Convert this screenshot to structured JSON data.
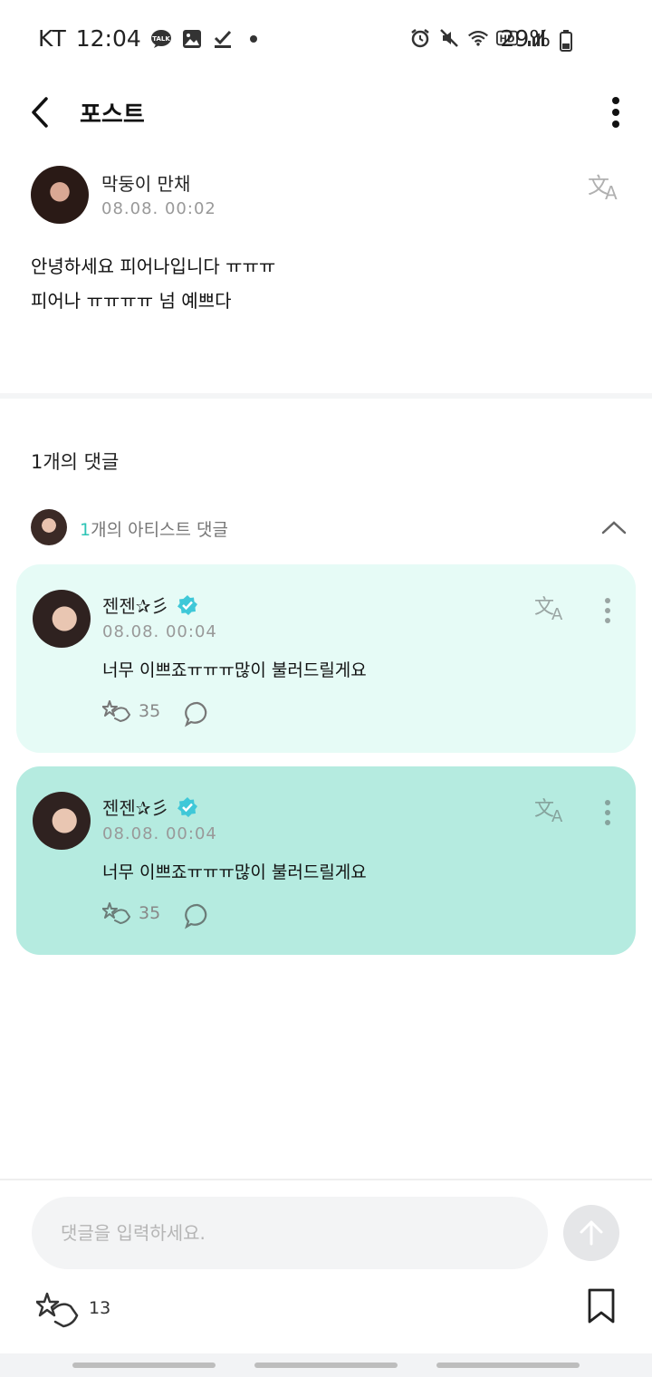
{
  "status_bar": {
    "carrier": "KT",
    "time": "12:04",
    "battery": "29%"
  },
  "header": {
    "title": "포스트"
  },
  "post": {
    "author": "막둥이 만채",
    "date": "08.08. 00:02",
    "body": "안녕하세요 피어나입니다 ㅠㅠㅠ\n피어나 ㅠㅠㅠㅠ 넘 예쁘다"
  },
  "comments_section": {
    "count_label": "1개의 댓글",
    "artist_label_num": "1",
    "artist_label_rest": "개의 아티스트 댓글"
  },
  "comments": [
    {
      "name": "젠젠✰彡",
      "date": "08.08. 00:04",
      "text": "너무 이쁘죠ㅠㅠㅠ많이 불러드릴게요",
      "likes": "35"
    },
    {
      "name": "젠젠✰彡",
      "date": "08.08. 00:04",
      "text": "너무 이쁘죠ㅠㅠㅠ많이 불러드릴게요",
      "likes": "35"
    }
  ],
  "bottom_bar": {
    "input_placeholder": "댓글을 입력하세요.",
    "like_count": "13"
  },
  "icons": {
    "back": "chevron-left-icon",
    "more": "more-vertical-icon",
    "translate": "translate-icon",
    "verified": "verified-badge-icon",
    "like": "star-hand-icon",
    "reply": "comment-bubble-icon",
    "send": "arrow-up-icon",
    "bookmark": "bookmark-icon",
    "collapse": "chevron-up-icon"
  },
  "colors": {
    "accent": "#2ec4b6",
    "card_light": "#e6fbf6",
    "card_highlight": "#b5ebe0",
    "verified": "#3fc8d8"
  }
}
